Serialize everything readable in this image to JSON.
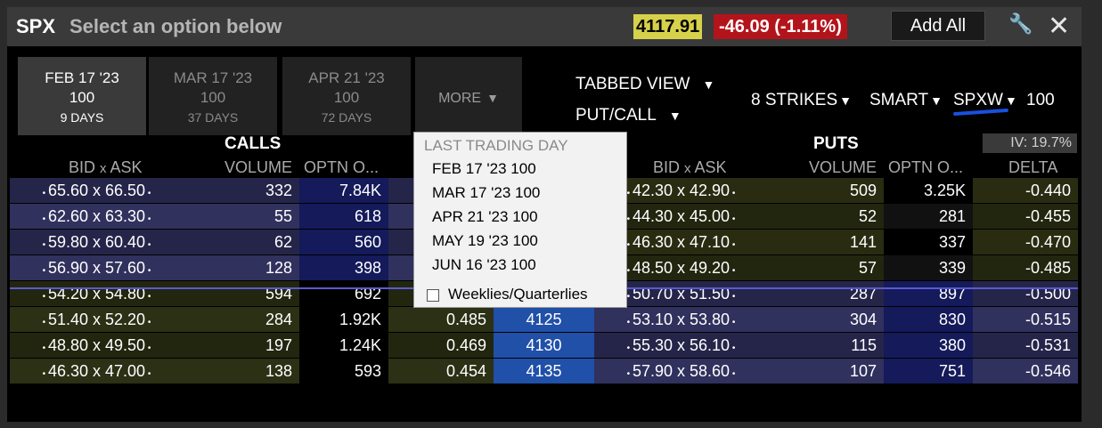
{
  "header": {
    "symbol": "SPX",
    "subtitle": "Select an option below",
    "last_price": "4117.91",
    "change": "-46.09 (-1.11%)",
    "add_all_label": "Add All",
    "colors": {
      "price_bg": "#d6d14b",
      "change_bg": "#b3141b"
    }
  },
  "tabs": [
    {
      "date": "FEB 17 '23",
      "mult": "100",
      "days": "9 DAYS"
    },
    {
      "date": "MAR 17 '23",
      "mult": "100",
      "days": "37 DAYS"
    },
    {
      "date": "APR 21 '23",
      "mult": "100",
      "days": "72 DAYS"
    }
  ],
  "more_label": "MORE",
  "controls": {
    "view": "TABBED VIEW",
    "type": "PUT/CALL",
    "strikes": "8 STRIKES",
    "exchange": "SMART",
    "trading_class": "SPXW",
    "multiplier": "100"
  },
  "sections": {
    "calls": "CALLS",
    "puts": "PUTS",
    "iv": "IV: 19.7%"
  },
  "columns": {
    "calls": {
      "bidask_bid": "BID",
      "bidask_x": "x",
      "bidask_ask": "ASK",
      "volume": "VOLUME",
      "open_int": "OPTN O..."
    },
    "puts": {
      "bidask_bid": "BID",
      "bidask_x": "x",
      "bidask_ask": "ASK",
      "volume": "VOLUME",
      "open_int": "OPTN O...",
      "delta": "DELTA"
    }
  },
  "rows": [
    {
      "call_bidask": "65.60 x 66.50",
      "call_vol": "332",
      "call_oi": "7.84K",
      "call_delta": "",
      "strike": "",
      "put_bidask": "42.30 x 42.90",
      "put_vol": "509",
      "put_oi": "3.25K",
      "put_delta": "-0.440"
    },
    {
      "call_bidask": "62.60 x 63.30",
      "call_vol": "55",
      "call_oi": "618",
      "call_delta": "",
      "strike": "",
      "put_bidask": "44.30 x 45.00",
      "put_vol": "52",
      "put_oi": "281",
      "put_delta": "-0.455"
    },
    {
      "call_bidask": "59.80 x 60.40",
      "call_vol": "62",
      "call_oi": "560",
      "call_delta": "",
      "strike": "",
      "put_bidask": "46.30 x 47.10",
      "put_vol": "141",
      "put_oi": "337",
      "put_delta": "-0.470"
    },
    {
      "call_bidask": "56.90 x 57.60",
      "call_vol": "128",
      "call_oi": "398",
      "call_delta": "",
      "strike": "",
      "put_bidask": "48.50 x 49.20",
      "put_vol": "57",
      "put_oi": "339",
      "put_delta": "-0.485"
    },
    {
      "call_bidask": "54.20 x 54.80",
      "call_vol": "594",
      "call_oi": "692",
      "call_delta": "",
      "strike": "",
      "put_bidask": "50.70 x 51.50",
      "put_vol": "287",
      "put_oi": "897",
      "put_delta": "-0.500"
    },
    {
      "call_bidask": "51.40 x 52.20",
      "call_vol": "284",
      "call_oi": "1.92K",
      "call_delta": "0.485",
      "strike": "4125",
      "put_bidask": "53.10 x 53.80",
      "put_vol": "304",
      "put_oi": "830",
      "put_delta": "-0.515"
    },
    {
      "call_bidask": "48.80 x 49.50",
      "call_vol": "197",
      "call_oi": "1.24K",
      "call_delta": "0.469",
      "strike": "4130",
      "put_bidask": "55.30 x 56.10",
      "put_vol": "115",
      "put_oi": "380",
      "put_delta": "-0.531"
    },
    {
      "call_bidask": "46.30 x 47.00",
      "call_vol": "138",
      "call_oi": "593",
      "call_delta": "0.454",
      "strike": "4135",
      "put_bidask": "57.90 x 58.60",
      "put_vol": "107",
      "put_oi": "751",
      "put_delta": "-0.546"
    }
  ],
  "dropdown": {
    "heading": "LAST TRADING DAY",
    "items": [
      "FEB 17 '23 100",
      "MAR 17 '23 100",
      "APR 21 '23 100",
      "MAY 19 '23 100",
      "JUN 16 '23 100"
    ],
    "checkbox_label": "Weeklies/Quarterlies"
  }
}
